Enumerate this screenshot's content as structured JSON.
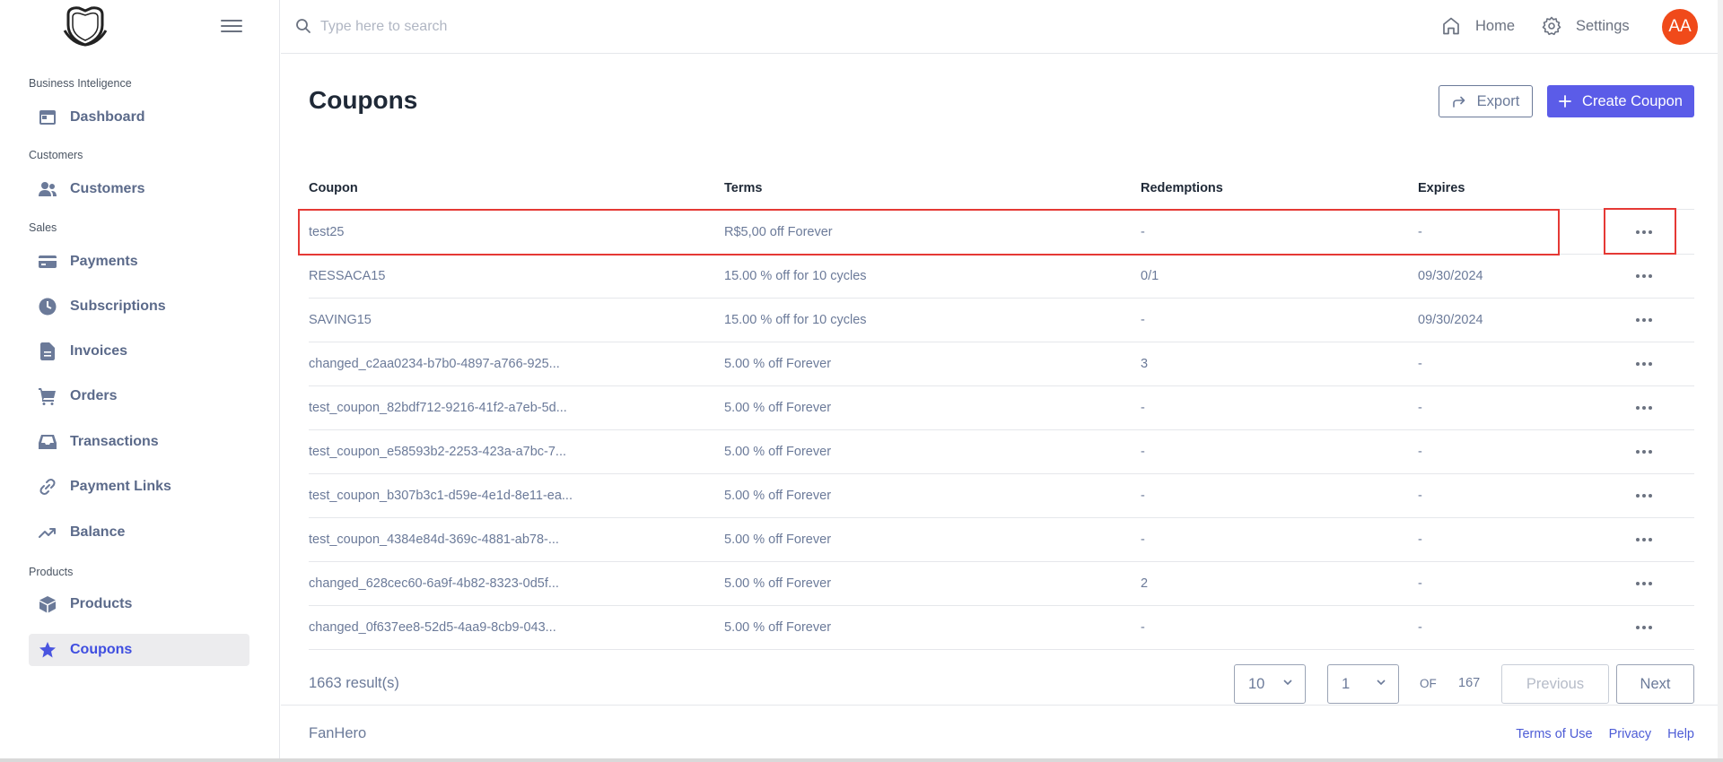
{
  "app": {
    "brand": "FanHero",
    "avatar_initials": "AA",
    "accent_color": "#5b5ce8",
    "avatar_color": "#f04a1a",
    "highlight_color": "#e53935"
  },
  "topbar": {
    "search_placeholder": "Type here to search",
    "home_label": "Home",
    "settings_label": "Settings"
  },
  "sidebar": {
    "sections": [
      {
        "label": "Business Inteligence"
      },
      {
        "label": "Customers"
      },
      {
        "label": "Sales"
      },
      {
        "label": "Products"
      }
    ],
    "items": [
      {
        "label": "Dashboard",
        "icon": "calendar-icon"
      },
      {
        "label": "Customers",
        "icon": "users-icon"
      },
      {
        "label": "Payments",
        "icon": "credit-card-icon"
      },
      {
        "label": "Subscriptions",
        "icon": "clock-icon"
      },
      {
        "label": "Invoices",
        "icon": "document-icon"
      },
      {
        "label": "Orders",
        "icon": "cart-icon"
      },
      {
        "label": "Transactions",
        "icon": "inbox-icon"
      },
      {
        "label": "Payment Links",
        "icon": "link-icon"
      },
      {
        "label": "Balance",
        "icon": "trend-up-icon"
      },
      {
        "label": "Products",
        "icon": "cube-icon"
      },
      {
        "label": "Coupons",
        "icon": "star-icon",
        "active": true
      }
    ]
  },
  "main": {
    "title": "Coupons",
    "export_label": "Export",
    "create_label": "Create Coupon",
    "columns": [
      "Coupon",
      "Terms",
      "Redemptions",
      "Expires"
    ],
    "rows": [
      {
        "coupon": "test25",
        "terms": "R$5,00 off Forever",
        "redemptions": "-",
        "expires": "-"
      },
      {
        "coupon": "RESSACA15",
        "terms": "15.00 % off for 10 cycles",
        "redemptions": "0/1",
        "expires": "09/30/2024"
      },
      {
        "coupon": "SAVING15",
        "terms": "15.00 % off for 10 cycles",
        "redemptions": "-",
        "expires": "09/30/2024"
      },
      {
        "coupon": "changed_c2aa0234-b7b0-4897-a766-925...",
        "terms": "5.00 % off Forever",
        "redemptions": "3",
        "expires": "-"
      },
      {
        "coupon": "test_coupon_82bdf712-9216-41f2-a7eb-5d...",
        "terms": "5.00 % off Forever",
        "redemptions": "-",
        "expires": "-"
      },
      {
        "coupon": "test_coupon_e58593b2-2253-423a-a7bc-7...",
        "terms": "5.00 % off Forever",
        "redemptions": "-",
        "expires": "-"
      },
      {
        "coupon": "test_coupon_b307b3c1-d59e-4e1d-8e11-ea...",
        "terms": "5.00 % off Forever",
        "redemptions": "-",
        "expires": "-"
      },
      {
        "coupon": "test_coupon_4384e84d-369c-4881-ab78-...",
        "terms": "5.00 % off Forever",
        "redemptions": "-",
        "expires": "-"
      },
      {
        "coupon": "changed_628cec60-6a9f-4b82-8323-0d5f...",
        "terms": "5.00 % off Forever",
        "redemptions": "2",
        "expires": "-"
      },
      {
        "coupon": "changed_0f637ee8-52d5-4aa9-8cb9-043...",
        "terms": "5.00 % off Forever",
        "redemptions": "-",
        "expires": "-"
      }
    ]
  },
  "pagination": {
    "results": "1663 result(s)",
    "page_size": "10",
    "current_page": "1",
    "of_label": "OF",
    "total_pages": "167",
    "previous_label": "Previous",
    "next_label": "Next"
  },
  "footer": {
    "links": [
      "Terms of Use",
      "Privacy",
      "Help"
    ]
  }
}
